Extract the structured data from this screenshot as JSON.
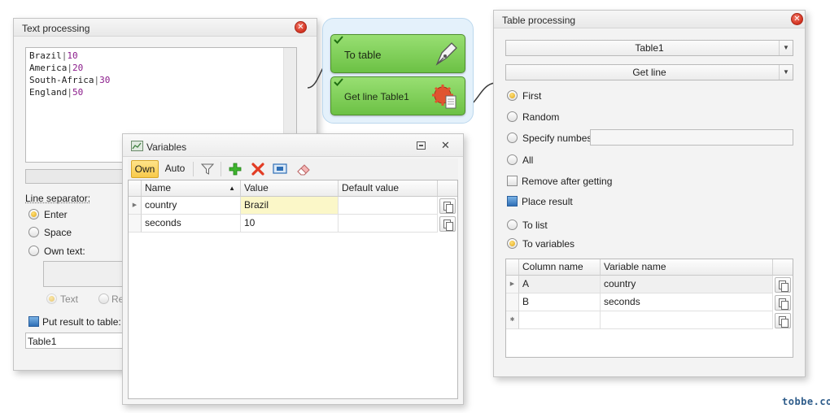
{
  "colors": {
    "panel_bg": "#f3f3f3",
    "node_green": "#7acc55",
    "accent_yellow": "#f8c94a",
    "close_red": "#d2311f",
    "code_number": "#8a1a8a"
  },
  "text_processing": {
    "title": "Text processing",
    "close_icon": "close-icon",
    "lines": [
      {
        "name": "Brazil",
        "sep": "|",
        "num": "10"
      },
      {
        "name": "America",
        "sep": "|",
        "num": "20"
      },
      {
        "name": "South-Africa",
        "sep": "|",
        "num": "30"
      },
      {
        "name": "England",
        "sep": "|",
        "num": "50"
      }
    ],
    "line_separator_label": "Line separator:",
    "options": {
      "enter": "Enter",
      "space": "Space",
      "own_text": "Own text:"
    },
    "selected_option": "Enter",
    "sub_options": {
      "text": "Text",
      "re": "Re"
    },
    "put_result_label": "Put result to table:",
    "put_result_value": "Table1"
  },
  "flow": {
    "nodes": [
      {
        "label": "To table",
        "icon": "pen-nib-icon",
        "status": "ok"
      },
      {
        "label": "Get line Table1",
        "icon": "gear-document-icon",
        "status": "ok"
      }
    ]
  },
  "variables": {
    "title": "Variables",
    "toolbar": {
      "own": "Own",
      "auto": "Auto",
      "icons": [
        "filter-icon",
        "add-icon",
        "delete-icon",
        "window-icon",
        "eraser-icon"
      ]
    },
    "columns": [
      "Name",
      "Value",
      "Default value"
    ],
    "rows": [
      {
        "name": "country",
        "value": "Brazil",
        "default": ""
      },
      {
        "name": "seconds",
        "value": "10",
        "default": ""
      }
    ]
  },
  "table_processing": {
    "title": "Table processing",
    "table_select": "Table1",
    "action_select": "Get line",
    "options": {
      "first": "First",
      "random": "Random",
      "specify": "Specify numbes",
      "all": "All"
    },
    "selected_option": "First",
    "remove_after": "Remove after getting",
    "place_result": "Place result",
    "place_options": {
      "list": "To list",
      "variables": "To variables"
    },
    "place_selected": "To variables",
    "columns": [
      "Column name",
      "Variable name"
    ],
    "rows": [
      {
        "col": "A",
        "var": "country"
      },
      {
        "col": "B",
        "var": "seconds"
      }
    ]
  },
  "watermark": "tobbe.co"
}
